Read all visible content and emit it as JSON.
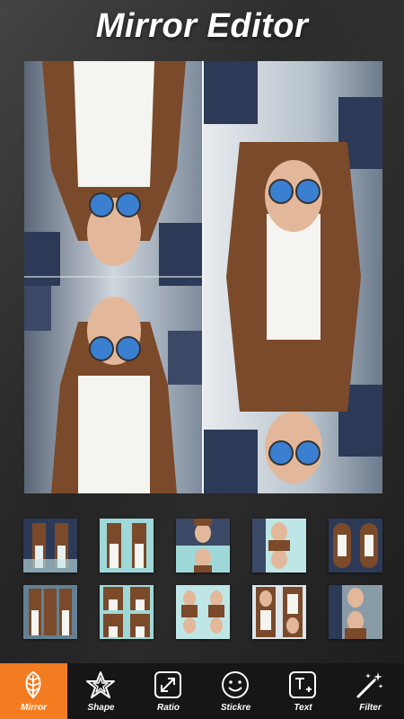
{
  "header": {
    "title": "Mirror Editor"
  },
  "colors": {
    "accent": "#f47c20",
    "toolbar_bg": "#161616",
    "background": "#2a2a2a"
  },
  "canvas": {
    "image": "mirrored-portrait-photo",
    "layout": "left half split vertically, right half mirrored"
  },
  "thumbnails": {
    "count": 10,
    "items": [
      "mirror-style-1",
      "mirror-style-2",
      "mirror-style-3",
      "mirror-style-4",
      "mirror-style-5",
      "mirror-style-6",
      "mirror-style-7",
      "mirror-style-8",
      "mirror-style-9",
      "mirror-style-10"
    ]
  },
  "toolbar": {
    "items": [
      {
        "label": "Mirror",
        "icon": "leaf-icon",
        "active": true
      },
      {
        "label": "Shape",
        "icon": "star-icon",
        "active": false
      },
      {
        "label": "Ratio",
        "icon": "resize-icon",
        "active": false
      },
      {
        "label": "Stickre",
        "icon": "smiley-icon",
        "active": false
      },
      {
        "label": "Text",
        "icon": "text-add-icon",
        "active": false
      },
      {
        "label": "Filter",
        "icon": "magic-wand-icon",
        "active": false
      }
    ]
  }
}
